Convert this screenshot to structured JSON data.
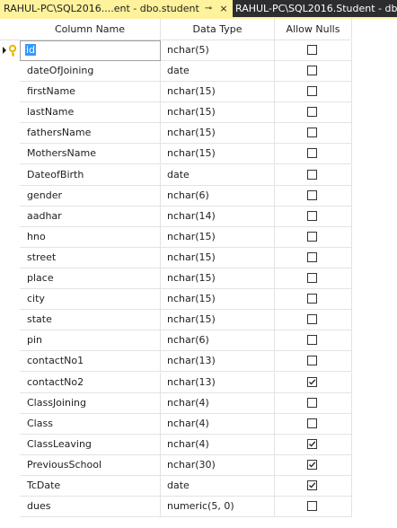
{
  "tabs": {
    "active_label": "RAHUL-PC\\SQL2016....ent - dbo.student",
    "pin_icon": "⊸",
    "close_icon": "×",
    "inactive_label": "RAHUL-PC\\SQL2016.Student - db"
  },
  "columns": {
    "name": "Column Name",
    "type": "Data Type",
    "nulls": "Allow Nulls"
  },
  "rows": [
    {
      "name": "id",
      "type": "nchar(5)",
      "allow_null": false
    },
    {
      "name": "dateOfJoining",
      "type": "date",
      "allow_null": false
    },
    {
      "name": "firstName",
      "type": "nchar(15)",
      "allow_null": false
    },
    {
      "name": "lastName",
      "type": "nchar(15)",
      "allow_null": false
    },
    {
      "name": "fathersName",
      "type": "nchar(15)",
      "allow_null": false
    },
    {
      "name": "MothersName",
      "type": "nchar(15)",
      "allow_null": false
    },
    {
      "name": "DateofBirth",
      "type": "date",
      "allow_null": false
    },
    {
      "name": "gender",
      "type": "nchar(6)",
      "allow_null": false
    },
    {
      "name": "aadhar",
      "type": "nchar(14)",
      "allow_null": false
    },
    {
      "name": "hno",
      "type": "nchar(15)",
      "allow_null": false
    },
    {
      "name": "street",
      "type": "nchar(15)",
      "allow_null": false
    },
    {
      "name": "place",
      "type": "nchar(15)",
      "allow_null": false
    },
    {
      "name": "city",
      "type": "nchar(15)",
      "allow_null": false
    },
    {
      "name": "state",
      "type": "nchar(15)",
      "allow_null": false
    },
    {
      "name": "pin",
      "type": "nchar(6)",
      "allow_null": false
    },
    {
      "name": "contactNo1",
      "type": "nchar(13)",
      "allow_null": false
    },
    {
      "name": "contactNo2",
      "type": "nchar(13)",
      "allow_null": true
    },
    {
      "name": "ClassJoining",
      "type": "nchar(4)",
      "allow_null": false
    },
    {
      "name": "Class",
      "type": "nchar(4)",
      "allow_null": false
    },
    {
      "name": "ClassLeaving",
      "type": "nchar(4)",
      "allow_null": true
    },
    {
      "name": "PreviousSchool",
      "type": "nchar(30)",
      "allow_null": true
    },
    {
      "name": "TcDate",
      "type": "date",
      "allow_null": true
    },
    {
      "name": "dues",
      "type": "numeric(5, 0)",
      "allow_null": false
    }
  ],
  "colors": {
    "active_tab": "#fff29d",
    "tab_bar": "#2d2d30",
    "grid_line": "#e3e3e3",
    "selection": "#3399ff",
    "key_icon": "#e8b800"
  },
  "icons": {
    "row_marker": "current-row-arrow-icon",
    "primary_key": "primary-key-icon",
    "checkbox_check": "check-icon"
  }
}
